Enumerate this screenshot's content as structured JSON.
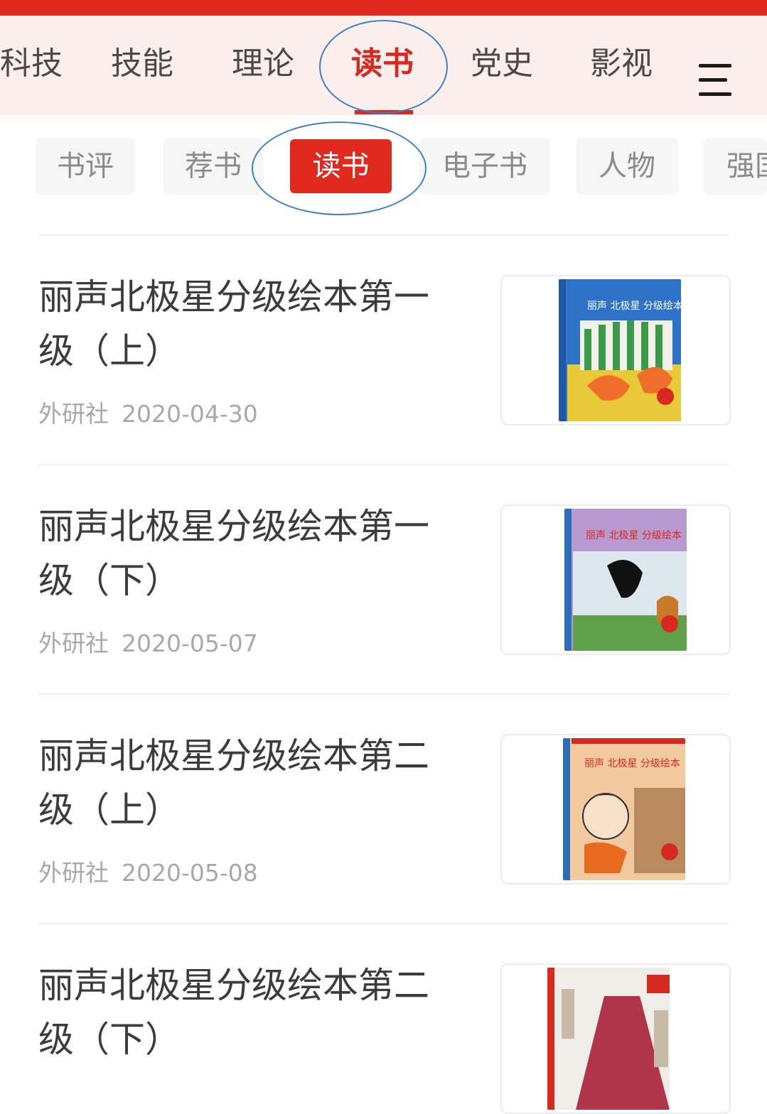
{
  "nav": {
    "tabs": [
      {
        "label": "科技"
      },
      {
        "label": "技能"
      },
      {
        "label": "理论"
      },
      {
        "label": "读书",
        "active": true
      },
      {
        "label": "党史"
      },
      {
        "label": "影视"
      }
    ],
    "menu_icon": "hamburger-menu-icon"
  },
  "subnav": {
    "chips": [
      {
        "label": "书评"
      },
      {
        "label": "荐书"
      },
      {
        "label": "读书",
        "active": true
      },
      {
        "label": "电子书"
      },
      {
        "label": "人物"
      },
      {
        "label": "强国"
      }
    ]
  },
  "articles": [
    {
      "title": "丽声北极星分级绘本第一级（上）",
      "source": "外研社",
      "date": "2020-04-30",
      "cover_text": "丽声 北极星 分级绘本"
    },
    {
      "title": "丽声北极星分级绘本第一级（下）",
      "source": "外研社",
      "date": "2020-05-07",
      "cover_text": "丽声 北极星 分级绘本"
    },
    {
      "title": "丽声北极星分级绘本第二级（上）",
      "source": "外研社",
      "date": "2020-05-08",
      "cover_text": "丽声 北极星 分级绘本"
    },
    {
      "title": "丽声北极星分级绘本第二级（下）",
      "source": "",
      "date": "",
      "cover_text": ""
    }
  ],
  "colors": {
    "accent": "#e12a1f",
    "nav_bg": "#fdeeee",
    "annotation_circle": "#3a82c4"
  }
}
